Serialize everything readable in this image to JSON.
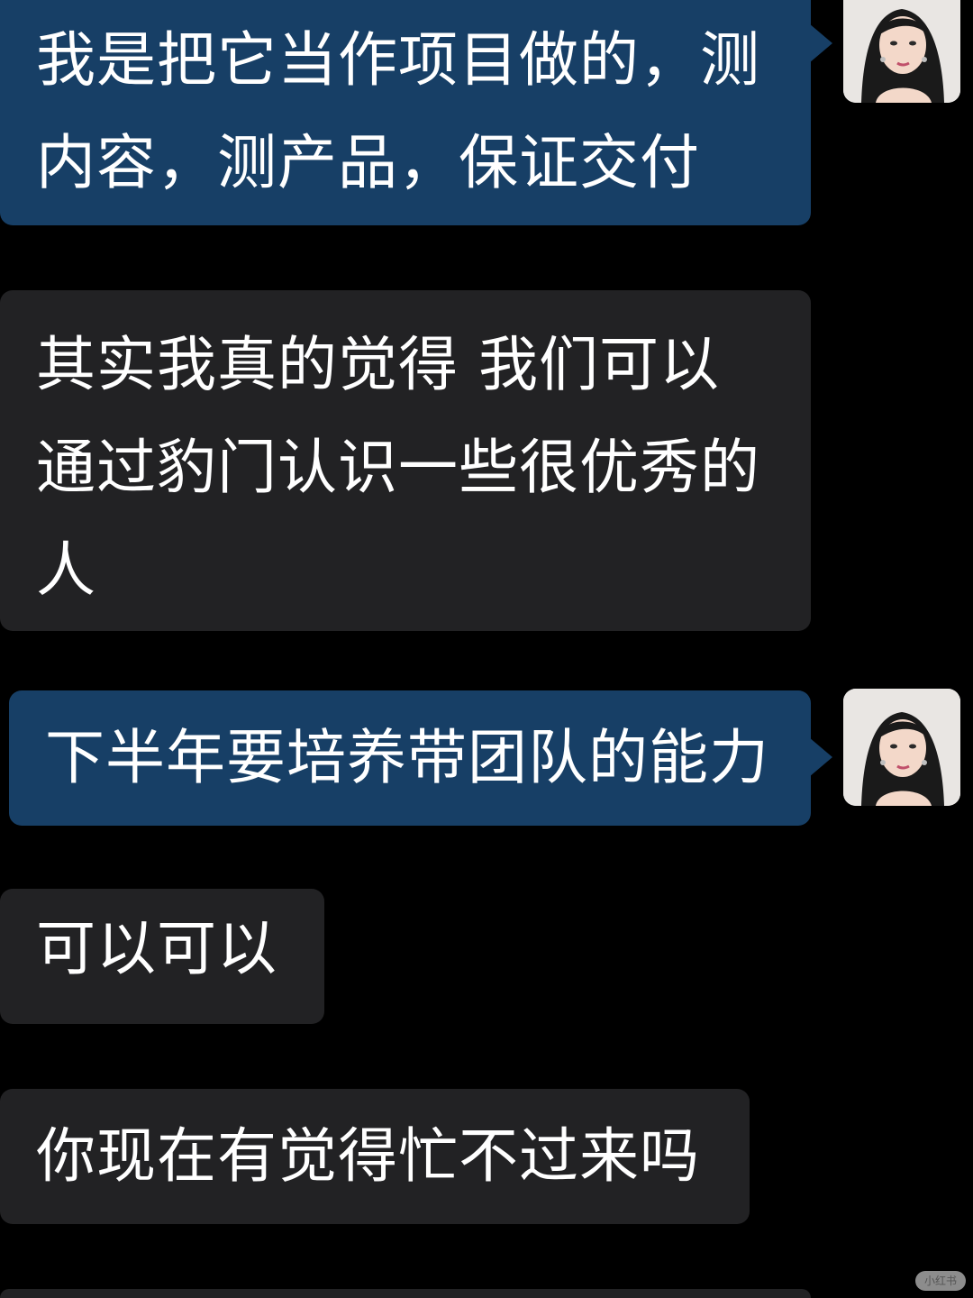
{
  "conversation": {
    "messages": [
      {
        "side": "sent",
        "lines": [
          "我是把它当作项目做的，测",
          "内容，测产品，保证交付"
        ]
      },
      {
        "side": "received",
        "lines": [
          "其实我真的觉得 我们可以",
          "通过豹门认识一些很优秀的",
          "人"
        ]
      },
      {
        "side": "sent",
        "lines": [
          "下半年要培养带团队的能力"
        ]
      },
      {
        "side": "received",
        "lines": [
          "可以可以"
        ]
      },
      {
        "side": "received",
        "lines": [
          "你现在有觉得忙不过来吗"
        ]
      }
    ]
  },
  "theme": {
    "background": "#000000",
    "sent_bubble": "#173f66",
    "received_bubble": "#222224",
    "text": "#ffffff"
  },
  "icons": {
    "avatar": "user-avatar-photo"
  },
  "watermark": "小红书"
}
